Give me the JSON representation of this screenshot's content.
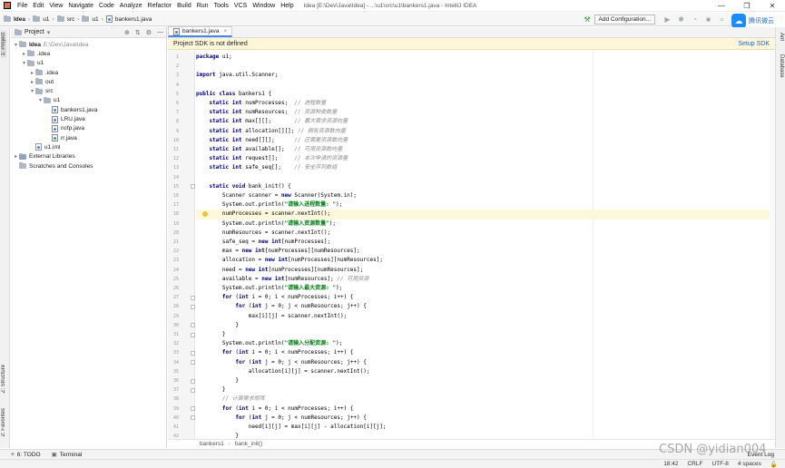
{
  "menubar": {
    "items": [
      "File",
      "Edit",
      "View",
      "Navigate",
      "Code",
      "Analyze",
      "Refactor",
      "Build",
      "Run",
      "Tools",
      "VCS",
      "Window",
      "Help"
    ],
    "window_title": "Idea [E:\\Dev\\Java\\Idea] - ...\\u1\\src\\u1\\bankers1.java - IntelliJ IDEA"
  },
  "navbar": {
    "crumbs": [
      "Idea",
      "u1",
      "src",
      "u1",
      "bankers1.java"
    ],
    "add_config_label": "Add Configuration..."
  },
  "cloud": {
    "label": "腾讯微云"
  },
  "left_strip": {
    "project": "1: Project",
    "structure": "Z: Structure",
    "favorites": "2: Favorites"
  },
  "right_strip": {
    "ant": "Ant",
    "database": "Database"
  },
  "project_panel": {
    "title": "Project",
    "tree": [
      {
        "level": 0,
        "arrow": "v",
        "icon": "folder",
        "label": "Idea",
        "extra": "E:\\Dev\\Java\\Idea",
        "bold": true
      },
      {
        "level": 1,
        "arrow": ">",
        "icon": "folder",
        "label": ".idea"
      },
      {
        "level": 1,
        "arrow": "v",
        "icon": "folder",
        "label": "u1"
      },
      {
        "level": 2,
        "arrow": ">",
        "icon": "folder",
        "label": ".idea"
      },
      {
        "level": 2,
        "arrow": ">",
        "icon": "folder",
        "label": "out"
      },
      {
        "level": 2,
        "arrow": "v",
        "icon": "folder",
        "label": "src"
      },
      {
        "level": 3,
        "arrow": "v",
        "icon": "folder",
        "label": "u1"
      },
      {
        "level": 4,
        "arrow": "",
        "icon": "java",
        "label": "bankers1.java"
      },
      {
        "level": 4,
        "arrow": "",
        "icon": "java",
        "label": "LRU.java"
      },
      {
        "level": 4,
        "arrow": "",
        "icon": "java",
        "label": "ncfp.java"
      },
      {
        "level": 4,
        "arrow": "",
        "icon": "java",
        "label": "rr.java"
      },
      {
        "level": 2,
        "arrow": "",
        "icon": "iml",
        "label": "u1.iml"
      },
      {
        "level": 0,
        "arrow": ">",
        "icon": "lib",
        "label": "External Libraries"
      },
      {
        "level": 0,
        "arrow": "",
        "icon": "scratch",
        "label": "Scratches and Consoles"
      }
    ]
  },
  "editor": {
    "tab_label": "bankers1.java",
    "sdk_warning": "Project SDK is not defined",
    "sdk_link": "Setup SDK",
    "current_line": 18,
    "lines": [
      "package u1;",
      "",
      "import java.util.Scanner;",
      "",
      "public class bankers1 {",
      "    static int numProcesses;  // 进程数量",
      "    static int numResources;  // 资源种类数量",
      "    static int max[][];       // 最大需求资源向量",
      "    static int allocation[][]; // 拥有资源数向量",
      "    static int need[][];      // 还需要资源数向量",
      "    static int available[];   // 可用资源数向量",
      "    static int request[];     // 本次申请的资源量",
      "    static int safe_seq[];    // 安全序列数组",
      "",
      "    static void bank_init() {",
      "        Scanner scanner = new Scanner(System.in);",
      "        System.out.println(\"请输入进程数量: \");",
      "        numProcesses = scanner.nextInt();",
      "        System.out.println(\"请输入资源数量\");",
      "        numResources = scanner.nextInt();",
      "        safe_seq = new int[numProcesses];",
      "        max = new int[numProcesses][numResources];",
      "        allocation = new int[numProcesses][numResources];",
      "        need = new int[numProcesses][numResources];",
      "        available = new int[numResources]; // 可用资源",
      "        System.out.println(\"请输入最大资源: \");",
      "        for (int i = 0; i < numProcesses; i++) {",
      "            for (int j = 0; j < numResources; j++) {",
      "                max[i][j] = scanner.nextInt();",
      "            }",
      "        }",
      "        System.out.println(\"请输入分配资源: \");",
      "        for (int i = 0; i < numProcesses; i++) {",
      "            for (int j = 0; j < numResources; j++) {",
      "                allocation[i][j] = scanner.nextInt();",
      "            }",
      "        }",
      "        // 计算需求矩阵",
      "        for (int i = 0; i < numProcesses; i++) {",
      "            for (int j = 0; j < numResources; j++) {",
      "                need[i][j] = max[i][j] - allocation[i][j];",
      "            }"
    ],
    "breadcrumb": [
      "bankers1",
      "bank_init()"
    ]
  },
  "bottom_tools": {
    "todo": "6: TODO",
    "terminal": "Terminal"
  },
  "status": {
    "position": "18:42",
    "line_sep": "CRLF",
    "encoding": "UTF-8",
    "indent": "4 spaces",
    "event_log": "Event Log"
  },
  "watermark": "CSDN @yidian004"
}
